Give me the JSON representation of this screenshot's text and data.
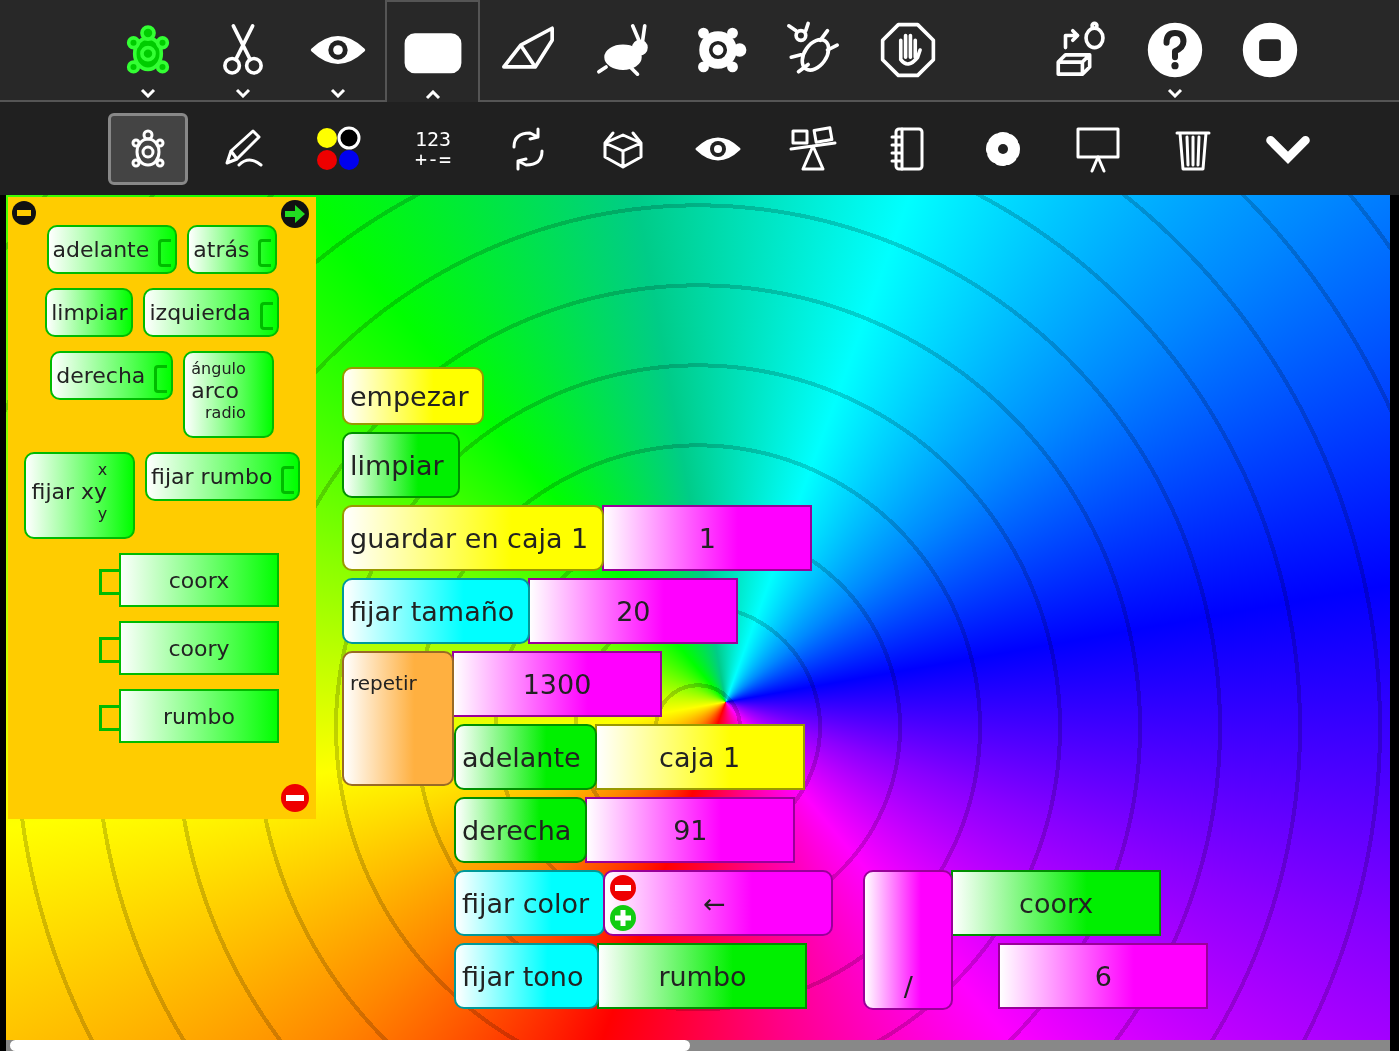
{
  "main_toolbar": [
    {
      "kind": "turtle",
      "selected": false,
      "menu": true
    },
    {
      "kind": "scissors",
      "selected": false,
      "menu": true
    },
    {
      "kind": "eye",
      "selected": false,
      "menu": true
    },
    {
      "kind": "blocks",
      "selected": true,
      "menu": true
    },
    {
      "kind": "eraser",
      "selected": false,
      "menu": false
    },
    {
      "kind": "rabbit",
      "selected": false,
      "menu": false
    },
    {
      "kind": "slow-turtle",
      "selected": false,
      "menu": false
    },
    {
      "kind": "bug",
      "selected": false,
      "menu": false
    },
    {
      "kind": "stop-hand",
      "selected": false,
      "menu": false
    },
    {
      "kind": "load",
      "selected": false,
      "menu": false
    },
    {
      "kind": "help",
      "selected": false,
      "menu": true
    },
    {
      "kind": "stop",
      "selected": false,
      "menu": false
    }
  ],
  "palette_toolbar": [
    {
      "kind": "turtle-outline",
      "selected": true
    },
    {
      "kind": "pen",
      "selected": false
    },
    {
      "kind": "colors",
      "selected": false
    },
    {
      "kind": "numbers",
      "selected": false,
      "lines": [
        "123",
        "+-="
      ]
    },
    {
      "kind": "rotate",
      "selected": false
    },
    {
      "kind": "box",
      "selected": false
    },
    {
      "kind": "eye",
      "selected": false
    },
    {
      "kind": "seesaw",
      "selected": false
    },
    {
      "kind": "notebook",
      "selected": false
    },
    {
      "kind": "gear",
      "selected": false
    },
    {
      "kind": "easel",
      "selected": false
    },
    {
      "kind": "trash",
      "selected": false
    },
    {
      "kind": "more",
      "selected": false
    }
  ],
  "palette": {
    "rows": [
      [
        {
          "kind": "command",
          "label": "adelante",
          "socket": true
        },
        {
          "kind": "command",
          "label": "atrás",
          "socket": true
        }
      ],
      [
        {
          "kind": "command",
          "label": "limpiar",
          "socket": false
        },
        {
          "kind": "command",
          "label": "izquierda",
          "socket": true
        }
      ],
      [
        {
          "kind": "command",
          "label": "derecha",
          "socket": true
        },
        {
          "kind": "two_arg",
          "label": "arco",
          "args": [
            "ángulo",
            "radio"
          ]
        }
      ],
      [
        {
          "kind": "two_arg",
          "label": "fijar xy",
          "args": [
            "x",
            "y"
          ]
        },
        {
          "kind": "command",
          "label": "fijar rumbo",
          "socket": true
        }
      ],
      [
        {
          "kind": "value",
          "label": "coorx"
        }
      ],
      [
        {
          "kind": "value",
          "label": "coory"
        }
      ],
      [
        {
          "kind": "value",
          "label": "rumbo"
        }
      ]
    ]
  },
  "program": [
    {
      "kind": "hat",
      "color": "#ffff00",
      "label": "empezar"
    },
    {
      "kind": "command",
      "color": "#00f000",
      "label": "limpiar"
    },
    {
      "kind": "command",
      "color": "#ffff00",
      "label": "guardar en caja 1",
      "args": [
        {
          "kind": "value",
          "color": "#ff00ff",
          "label": "1"
        }
      ]
    },
    {
      "kind": "command",
      "color": "#00ffff",
      "label": "fijar tamaño",
      "args": [
        {
          "kind": "value",
          "color": "#ff00ff",
          "label": "20"
        }
      ]
    },
    {
      "kind": "clamp",
      "color": "#ffb040",
      "label": "repetir",
      "args": [
        {
          "kind": "value",
          "color": "#ff00ff",
          "label": "1300"
        }
      ],
      "children": [
        {
          "kind": "command",
          "color": "#00f000",
          "label": "adelante",
          "args": [
            {
              "kind": "value",
              "color": "#ffff00",
              "label": "caja 1"
            }
          ]
        },
        {
          "kind": "command",
          "color": "#00f000",
          "label": "derecha",
          "args": [
            {
              "kind": "value",
              "color": "#ff00ff",
              "label": "91"
            }
          ]
        },
        {
          "kind": "command",
          "color": "#00ffff",
          "label": "fijar color",
          "args": [
            {
              "kind": "expandable",
              "color": "#ff00ff",
              "label": "←",
              "args": [
                {
                  "kind": "divide",
                  "color": "#ff00ff",
                  "label": "/",
                  "args": [
                    {
                      "kind": "value",
                      "color": "#00f000",
                      "label": "coorx"
                    },
                    {
                      "kind": "value",
                      "color": "#ff00ff",
                      "label": "6"
                    }
                  ]
                }
              ]
            }
          ]
        },
        {
          "kind": "command",
          "color": "#00ffff",
          "label": "fijar tono",
          "args": [
            {
              "kind": "value",
              "color": "#00f000",
              "label": "rumbo"
            }
          ]
        }
      ]
    }
  ]
}
